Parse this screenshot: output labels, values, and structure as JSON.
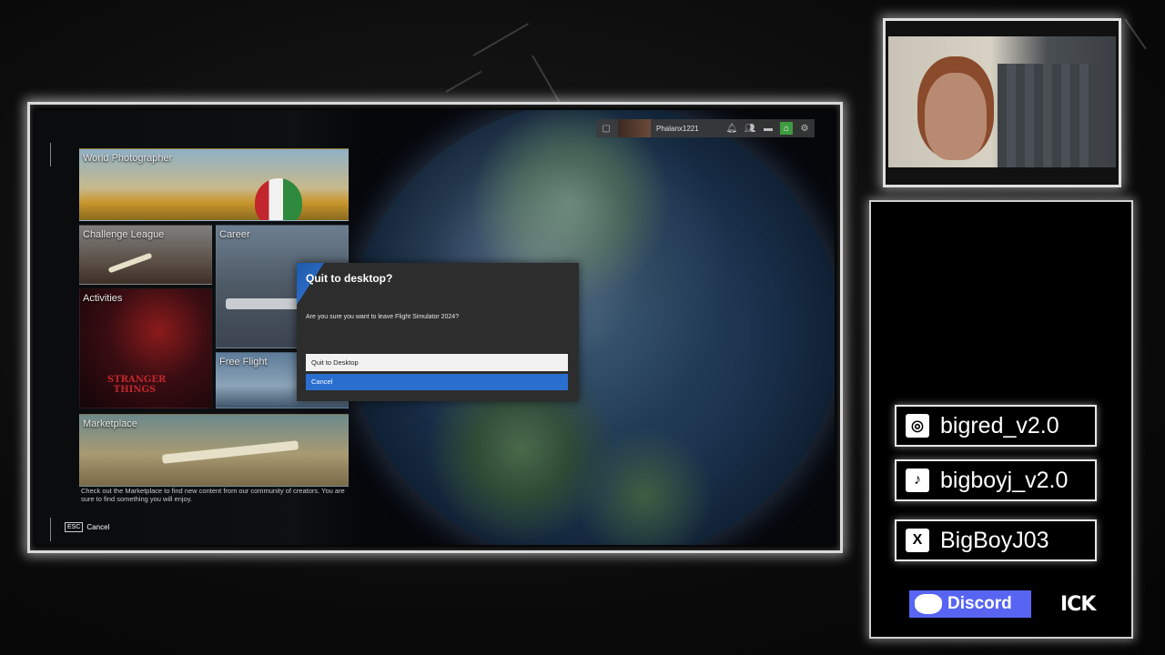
{
  "game": {
    "tiles": {
      "world_photographer": "World Photographer",
      "challenge_league": "Challenge League",
      "career": "Career",
      "activities": "Activities",
      "free_flight": "Free Flight",
      "marketplace": "Marketplace"
    },
    "marketplace_description": "Check out the Marketplace to find new content from our community of creators. You are sure to find something you will enjoy.",
    "activities_art_text": "STRANGER THINGS",
    "esc_key": "ESC",
    "esc_label": "Cancel"
  },
  "profile_bar": {
    "username": "Phalanx1221",
    "icons": [
      "level-badge-icon",
      "bell-icon",
      "friends-icon",
      "chat-icon",
      "store-icon",
      "gear-icon"
    ]
  },
  "dialog": {
    "title": "Quit to desktop?",
    "message": "Are you sure you want to leave Flight Simulator 2024?",
    "quit_label": "Quit to Desktop",
    "cancel_label": "Cancel",
    "accent_color": "#2a6fd0"
  },
  "socials": {
    "instagram": "bigred_v2.0",
    "tiktok": "bigboyj_v2.0",
    "x": "BigBoyJ03",
    "discord": "Discord",
    "ick_logo": "ICK"
  },
  "colors": {
    "discord": "#5865f2",
    "frame_glow": "#ffffff",
    "store_green": "#3f9b3f"
  }
}
